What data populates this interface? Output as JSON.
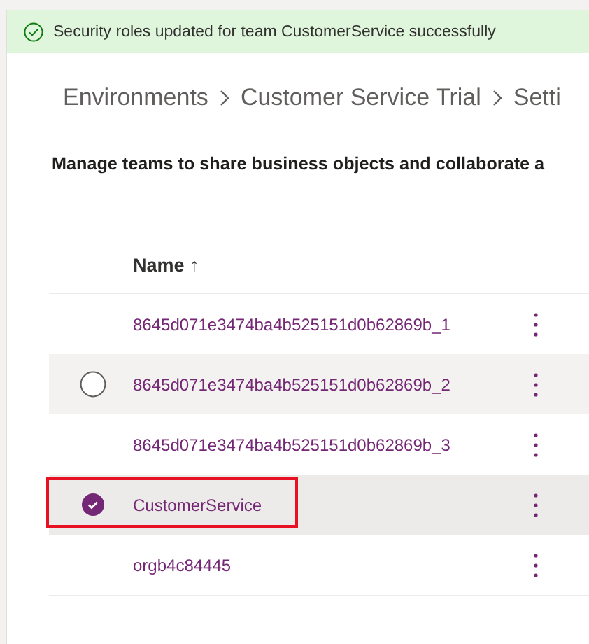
{
  "banner": {
    "message": "Security roles updated for team CustomerService successfully"
  },
  "breadcrumb": [
    "Environments",
    "Customer Service Trial",
    "Setti"
  ],
  "description": "Manage teams to share business objects and collaborate a",
  "table": {
    "columns": [
      {
        "label": "Name",
        "sort_icon": "↑"
      }
    ],
    "rows": [
      {
        "name": "8645d071e3474ba4b525151d0b62869b_1",
        "selected": false,
        "hovered": false,
        "highlighted": false
      },
      {
        "name": "8645d071e3474ba4b525151d0b62869b_2",
        "selected": false,
        "hovered": true,
        "highlighted": false
      },
      {
        "name": "8645d071e3474ba4b525151d0b62869b_3",
        "selected": false,
        "hovered": false,
        "highlighted": false
      },
      {
        "name": "CustomerService",
        "selected": true,
        "hovered": false,
        "highlighted": true
      },
      {
        "name": "orgb4c84445",
        "selected": false,
        "hovered": false,
        "highlighted": false
      }
    ]
  }
}
